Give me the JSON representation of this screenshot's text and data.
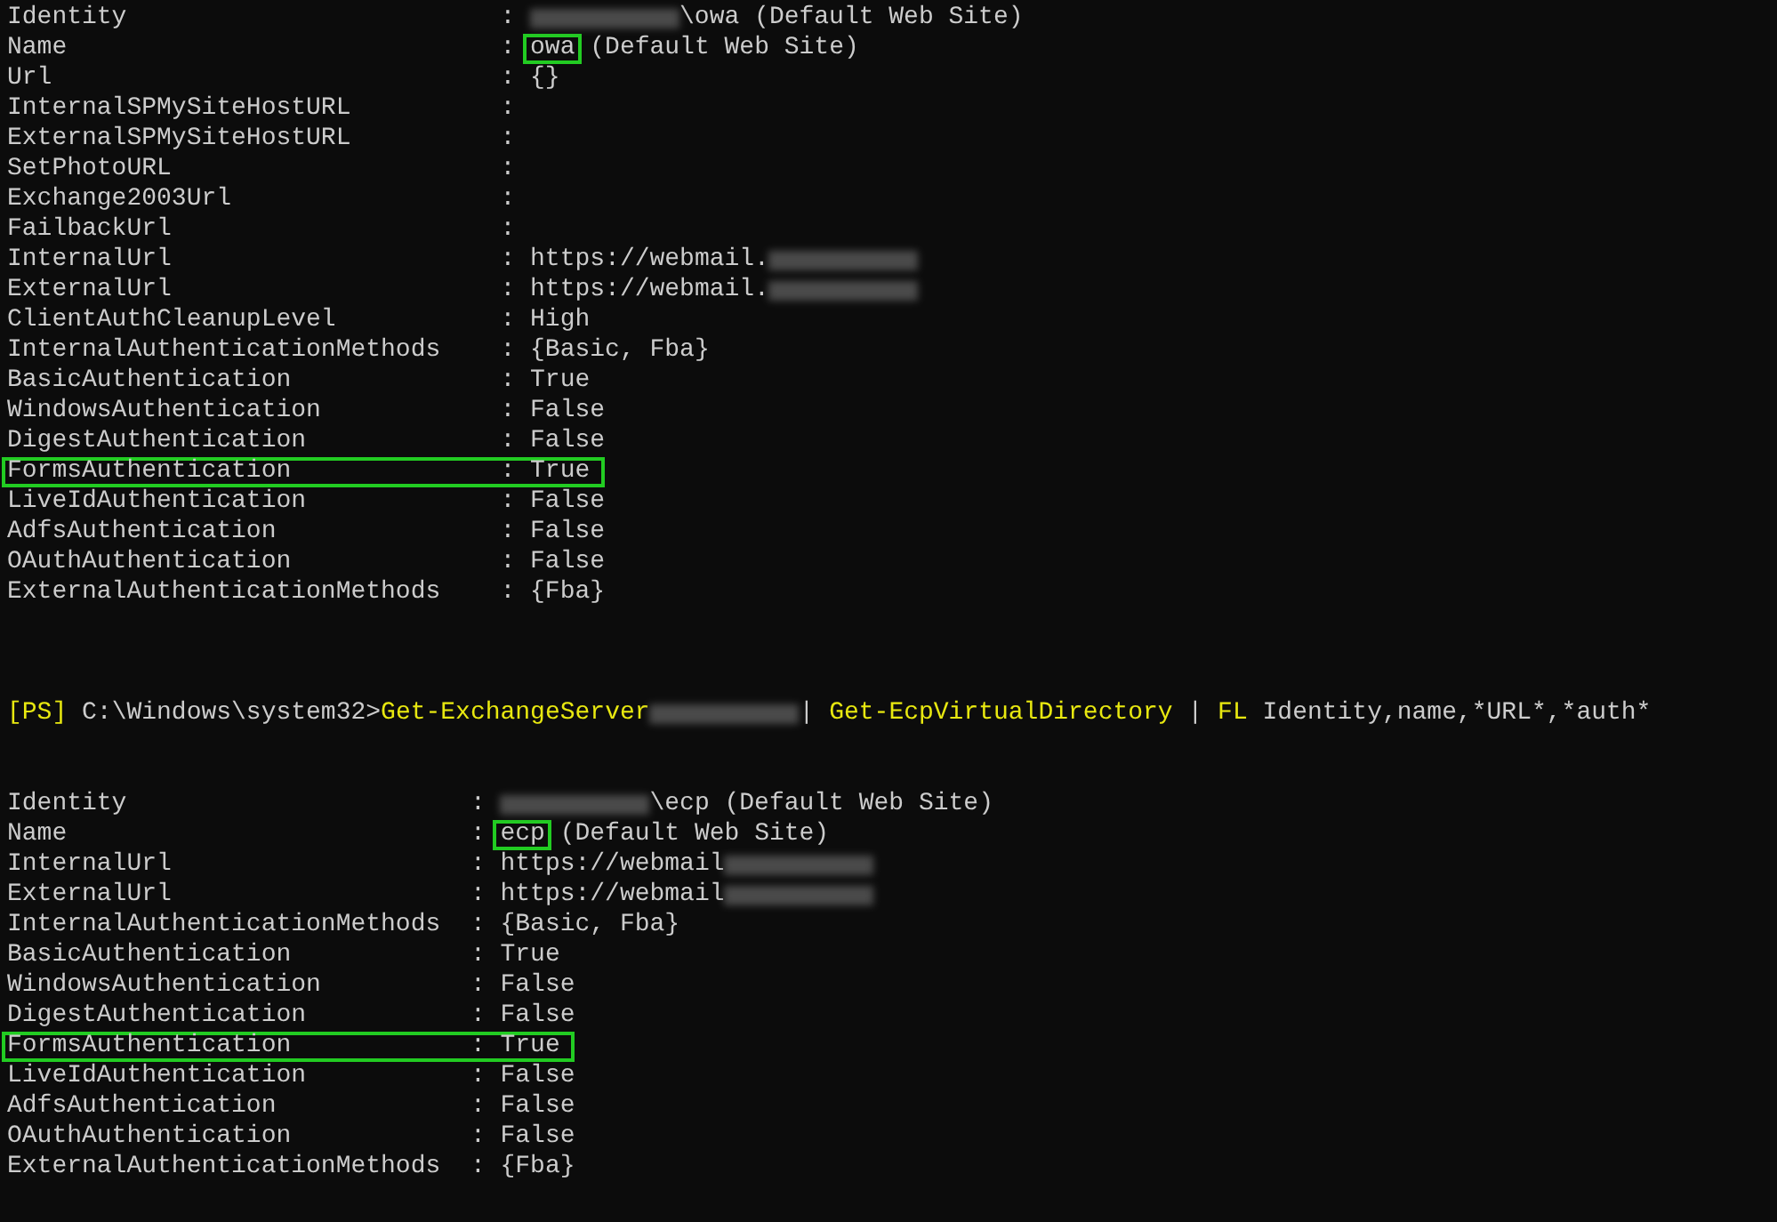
{
  "blocks": [
    {
      "rows": [
        {
          "key": "Identity",
          "separator": ":",
          "highlighted": false,
          "value": [
            {
              "kind": "redacted"
            },
            {
              "kind": "text",
              "text": "\\owa (Default Web Site)",
              "highlighted": false
            }
          ]
        },
        {
          "key": "Name",
          "separator": ":",
          "highlighted": false,
          "value": [
            {
              "kind": "text",
              "text": "owa",
              "highlighted": true
            },
            {
              "kind": "text",
              "text": " (Default Web Site)",
              "highlighted": false
            }
          ]
        },
        {
          "key": "Url",
          "separator": ":",
          "highlighted": false,
          "value": [
            {
              "kind": "text",
              "text": "{}",
              "highlighted": false
            }
          ]
        },
        {
          "key": "InternalSPMySiteHostURL",
          "separator": ":",
          "highlighted": false,
          "value": []
        },
        {
          "key": "ExternalSPMySiteHostURL",
          "separator": ":",
          "highlighted": false,
          "value": []
        },
        {
          "key": "SetPhotoURL",
          "separator": ":",
          "highlighted": false,
          "value": []
        },
        {
          "key": "Exchange2003Url",
          "separator": ":",
          "highlighted": false,
          "value": []
        },
        {
          "key": "FailbackUrl",
          "separator": ":",
          "highlighted": false,
          "value": []
        },
        {
          "key": "InternalUrl",
          "separator": ":",
          "highlighted": false,
          "value": [
            {
              "kind": "text",
              "text": "https://webmail.",
              "highlighted": false
            },
            {
              "kind": "redacted"
            }
          ]
        },
        {
          "key": "ExternalUrl",
          "separator": ":",
          "highlighted": false,
          "value": [
            {
              "kind": "text",
              "text": "https://webmail.",
              "highlighted": false
            },
            {
              "kind": "redacted"
            }
          ]
        },
        {
          "key": "ClientAuthCleanupLevel",
          "separator": ":",
          "highlighted": false,
          "value": [
            {
              "kind": "text",
              "text": "High",
              "highlighted": false
            }
          ]
        },
        {
          "key": "InternalAuthenticationMethods",
          "separator": ":",
          "highlighted": false,
          "value": [
            {
              "kind": "text",
              "text": "{Basic, Fba}",
              "highlighted": false
            }
          ]
        },
        {
          "key": "BasicAuthentication",
          "separator": ":",
          "highlighted": false,
          "value": [
            {
              "kind": "text",
              "text": "True",
              "highlighted": false
            }
          ]
        },
        {
          "key": "WindowsAuthentication",
          "separator": ":",
          "highlighted": false,
          "value": [
            {
              "kind": "text",
              "text": "False",
              "highlighted": false
            }
          ]
        },
        {
          "key": "DigestAuthentication",
          "separator": ":",
          "highlighted": false,
          "value": [
            {
              "kind": "text",
              "text": "False",
              "highlighted": false
            }
          ]
        },
        {
          "key": "FormsAuthentication",
          "separator": ":",
          "highlighted": true,
          "value": [
            {
              "kind": "text",
              "text": "True",
              "highlighted": false
            }
          ]
        },
        {
          "key": "LiveIdAuthentication",
          "separator": ":",
          "highlighted": false,
          "value": [
            {
              "kind": "text",
              "text": "False",
              "highlighted": false
            }
          ]
        },
        {
          "key": "AdfsAuthentication",
          "separator": ":",
          "highlighted": false,
          "value": [
            {
              "kind": "text",
              "text": "False",
              "highlighted": false
            }
          ]
        },
        {
          "key": "OAuthAuthentication",
          "separator": ":",
          "highlighted": false,
          "value": [
            {
              "kind": "text",
              "text": "False",
              "highlighted": false
            }
          ]
        },
        {
          "key": "ExternalAuthenticationMethods",
          "separator": ":",
          "highlighted": false,
          "value": [
            {
              "kind": "text",
              "text": "{Fba}",
              "highlighted": false
            }
          ]
        }
      ]
    },
    {
      "prompt": [
        {
          "kind": "text",
          "text": "[PS]",
          "color": "#e8e810"
        },
        {
          "kind": "text",
          "text": " C:\\Windows\\system32>",
          "color": "#cccccc"
        },
        {
          "kind": "text",
          "text": "Get-ExchangeServer",
          "color": "#e8e810"
        },
        {
          "kind": "redacted"
        },
        {
          "kind": "text",
          "text": "|",
          "color": "#cccccc"
        },
        {
          "kind": "text",
          "text": " Get-EcpVirtualDirectory ",
          "color": "#e8e810"
        },
        {
          "kind": "text",
          "text": "| ",
          "color": "#cccccc"
        },
        {
          "kind": "text",
          "text": "FL",
          "color": "#e8e810"
        },
        {
          "kind": "text",
          "text": " Identity,name,*URL*,*auth*",
          "color": "#cccccc"
        }
      ],
      "rows": [
        {
          "key": "Identity",
          "separator": ":",
          "highlighted": false,
          "value": [
            {
              "kind": "redacted"
            },
            {
              "kind": "text",
              "text": "\\ecp (Default Web Site)",
              "highlighted": false
            }
          ]
        },
        {
          "key": "Name",
          "separator": ":",
          "highlighted": false,
          "value": [
            {
              "kind": "text",
              "text": "ecp",
              "highlighted": true
            },
            {
              "kind": "text",
              "text": " (Default Web Site)",
              "highlighted": false
            }
          ]
        },
        {
          "key": "InternalUrl",
          "separator": ":",
          "highlighted": false,
          "value": [
            {
              "kind": "text",
              "text": "https://webmail",
              "highlighted": false
            },
            {
              "kind": "redacted"
            }
          ]
        },
        {
          "key": "ExternalUrl",
          "separator": ":",
          "highlighted": false,
          "value": [
            {
              "kind": "text",
              "text": "https://webmail",
              "highlighted": false
            },
            {
              "kind": "redacted"
            }
          ]
        },
        {
          "key": "InternalAuthenticationMethods",
          "separator": ":",
          "highlighted": false,
          "value": [
            {
              "kind": "text",
              "text": "{Basic, Fba}",
              "highlighted": false
            }
          ]
        },
        {
          "key": "BasicAuthentication",
          "separator": ":",
          "highlighted": false,
          "value": [
            {
              "kind": "text",
              "text": "True",
              "highlighted": false
            }
          ]
        },
        {
          "key": "WindowsAuthentication",
          "separator": ":",
          "highlighted": false,
          "value": [
            {
              "kind": "text",
              "text": "False",
              "highlighted": false
            }
          ]
        },
        {
          "key": "DigestAuthentication",
          "separator": ":",
          "highlighted": false,
          "value": [
            {
              "kind": "text",
              "text": "False",
              "highlighted": false
            }
          ]
        },
        {
          "key": "FormsAuthentication",
          "separator": ":",
          "highlighted": true,
          "value": [
            {
              "kind": "text",
              "text": "True",
              "highlighted": false
            }
          ]
        },
        {
          "key": "LiveIdAuthentication",
          "separator": ":",
          "highlighted": false,
          "value": [
            {
              "kind": "text",
              "text": "False",
              "highlighted": false
            }
          ]
        },
        {
          "key": "AdfsAuthentication",
          "separator": ":",
          "highlighted": false,
          "value": [
            {
              "kind": "text",
              "text": "False",
              "highlighted": false
            }
          ]
        },
        {
          "key": "OAuthAuthentication",
          "separator": ":",
          "highlighted": false,
          "value": [
            {
              "kind": "text",
              "text": "False",
              "highlighted": false
            }
          ]
        },
        {
          "key": "ExternalAuthenticationMethods",
          "separator": ":",
          "highlighted": false,
          "value": [
            {
              "kind": "text",
              "text": "{Fba}",
              "highlighted": false
            }
          ]
        }
      ]
    }
  ]
}
